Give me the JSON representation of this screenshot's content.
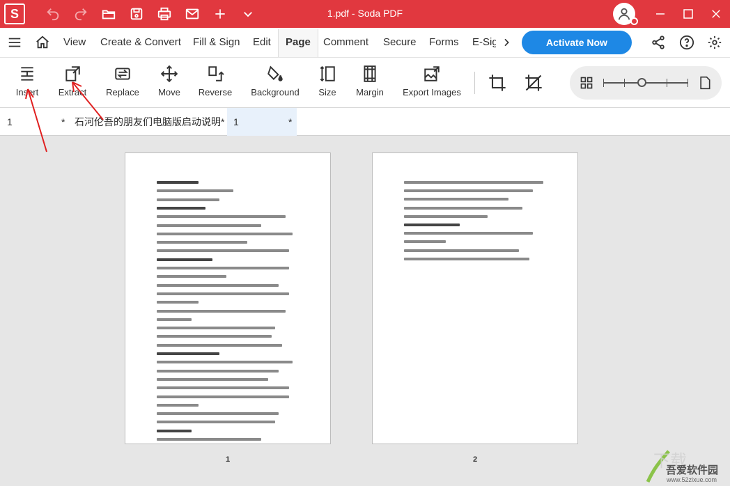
{
  "window": {
    "title": "1.pdf - Soda PDF",
    "logo_letter": "S",
    "accent_color": "#e1383f",
    "titlebar_icons": [
      "undo-icon",
      "redo-icon",
      "folder-open-icon",
      "save-icon",
      "print-icon",
      "mail-icon",
      "plus-icon",
      "chevron-down-icon"
    ],
    "window_controls": [
      "minimize-icon",
      "maximize-icon",
      "close-icon"
    ]
  },
  "menubar": {
    "items": [
      "View",
      "Create & Convert",
      "Fill & Sign",
      "Edit",
      "Page",
      "Comment",
      "Secure",
      "Forms"
    ],
    "truncated_item": "E-Sign",
    "active": "Page",
    "activate_label": "Activate Now",
    "activate_color": "#1e88e5",
    "right_icons": [
      "share-icon",
      "help-icon",
      "settings-icon"
    ]
  },
  "toolbar": {
    "tools": [
      "Insert",
      "Extract",
      "Replace",
      "Move",
      "Reverse",
      "Background",
      "Size",
      "Margin",
      "Export Images"
    ],
    "extra_icons": [
      "crop-icon",
      "crop-remove-icon"
    ],
    "zoom_level_fraction": 0.45
  },
  "tabs": [
    {
      "name": "1",
      "marker": "*"
    },
    {
      "name": "石河伦吾的朋友们电脑版启动说明*",
      "marker": ""
    },
    {
      "name": "1",
      "marker": "*"
    }
  ],
  "pages": [
    {
      "number": "1"
    },
    {
      "number": "2"
    }
  ],
  "watermark": {
    "text": "吾爱软件园",
    "url": "www.52zixue.com"
  }
}
